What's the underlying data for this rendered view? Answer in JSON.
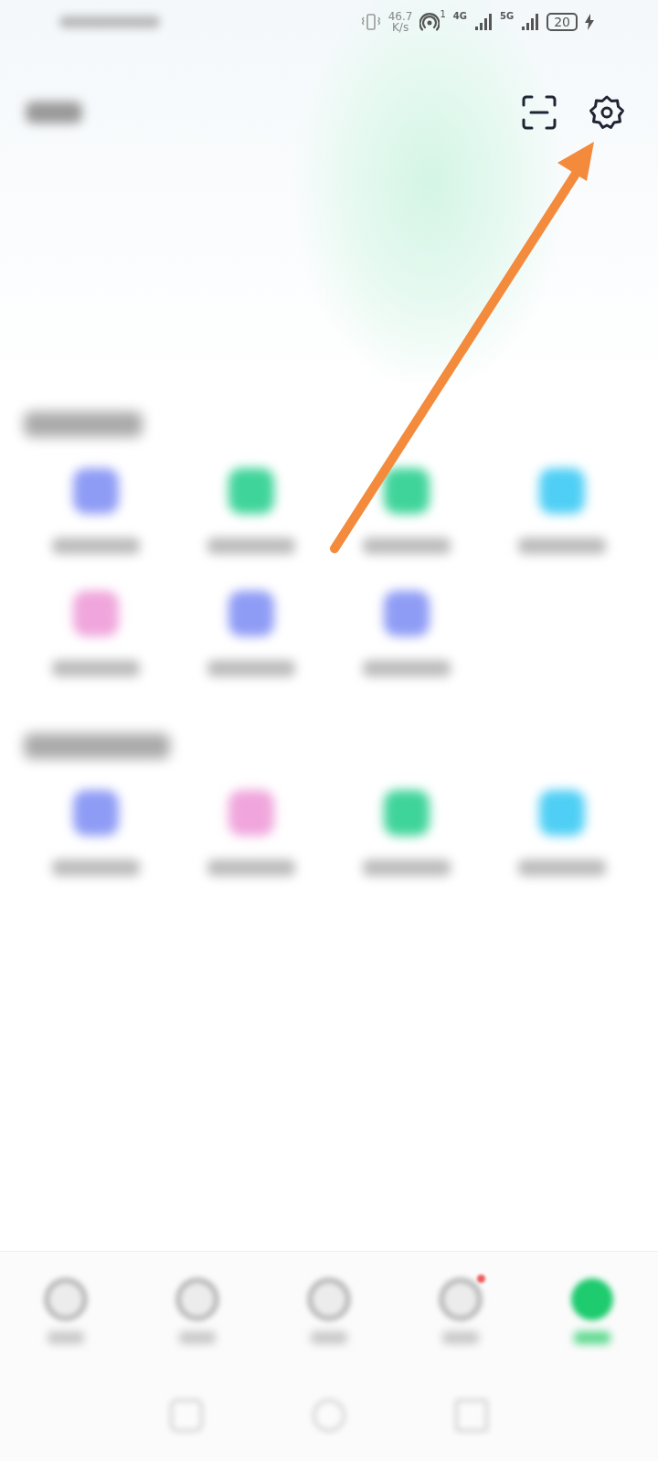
{
  "status_bar": {
    "speed_value": "46.7",
    "speed_unit": "K/s",
    "hotspot_count": "1",
    "network_1": "4G",
    "network_2": "5G",
    "battery": "20",
    "charging": true
  },
  "sections": [
    {
      "items": [
        {
          "color": "#8f9cf5"
        },
        {
          "color": "#3fd49a"
        },
        {
          "color": "#3fd49a"
        },
        {
          "color": "#4fcff5"
        },
        {
          "color": "#f0a6dc"
        },
        {
          "color": "#8f9cf5"
        },
        {
          "color": "#8f9cf5"
        }
      ]
    },
    {
      "items": [
        {
          "color": "#8f9cf5"
        },
        {
          "color": "#f0a6dc"
        },
        {
          "color": "#3fd49a"
        },
        {
          "color": "#4fcff5"
        }
      ]
    }
  ],
  "bottom_nav": [
    {
      "selected": false,
      "badge": false
    },
    {
      "selected": false,
      "badge": false
    },
    {
      "selected": false,
      "badge": false
    },
    {
      "selected": false,
      "badge": true
    },
    {
      "selected": true,
      "badge": false
    }
  ]
}
